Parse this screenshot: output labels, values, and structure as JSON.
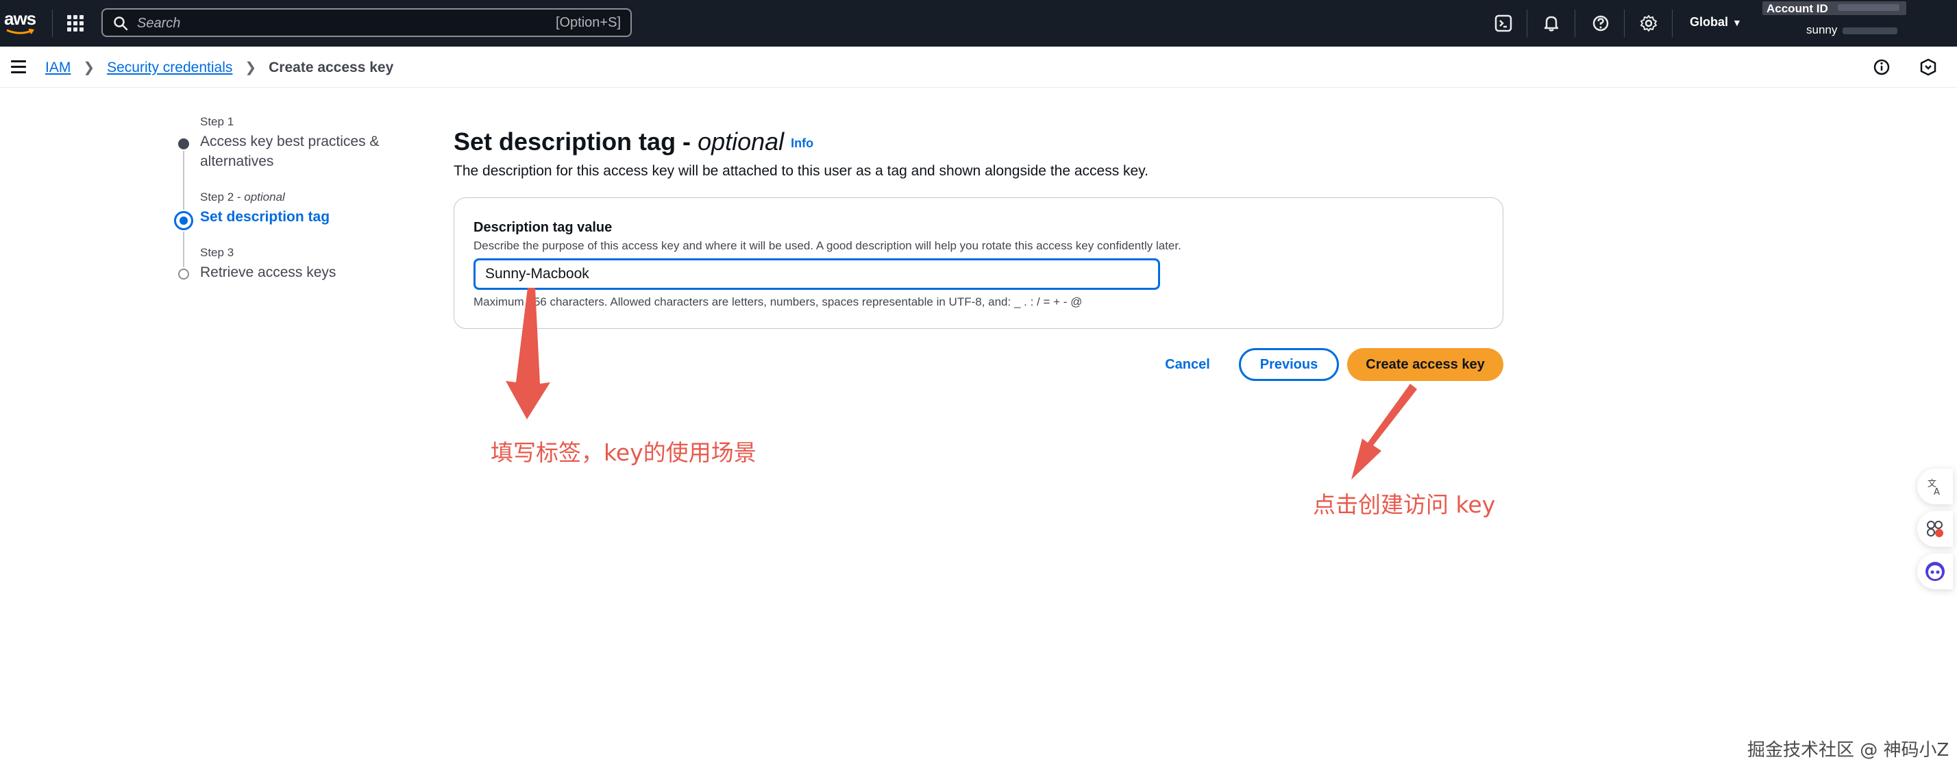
{
  "topnav": {
    "logo_text": "aws",
    "search_placeholder": "Search",
    "search_shortcut": "[Option+S]",
    "region": "Global",
    "account_label": "Account ID",
    "user_name": "sunny"
  },
  "breadcrumb": {
    "items": [
      "IAM",
      "Security credentials"
    ],
    "current": "Create access key"
  },
  "steps": [
    {
      "number": "Step 1",
      "optional": "",
      "label": "Access key best practices & alternatives",
      "state": "completed"
    },
    {
      "number": "Step 2",
      "optional": "optional",
      "label": "Set description tag",
      "state": "current"
    },
    {
      "number": "Step 3",
      "optional": "",
      "label": "Retrieve access keys",
      "state": "pending"
    }
  ],
  "main": {
    "title": "Set description tag -",
    "title_optional": "optional",
    "info_link": "Info",
    "description": "The description for this access key will be attached to this user as a tag and shown alongside the access key.",
    "field": {
      "label": "Description tag value",
      "description": "Describe the purpose of this access key and where it will be used. A good description will help you rotate this access key confidently later.",
      "value": "Sunny-Macbook",
      "hint": "Maximum 256 characters. Allowed characters are letters, numbers, spaces representable in UTF-8, and: _ . : / = + - @"
    },
    "buttons": {
      "cancel": "Cancel",
      "previous": "Previous",
      "create": "Create access key"
    }
  },
  "annotations": {
    "fill_tag": "填写标签，key的使用场景",
    "click_create": "点击创建访问 key",
    "color": "#e75a4d"
  },
  "watermark": "掘金技术社区 @ 神码小Z",
  "colors": {
    "nav_bg": "#161d26",
    "link": "#006ce0",
    "primary_button": "#f59e2a"
  }
}
